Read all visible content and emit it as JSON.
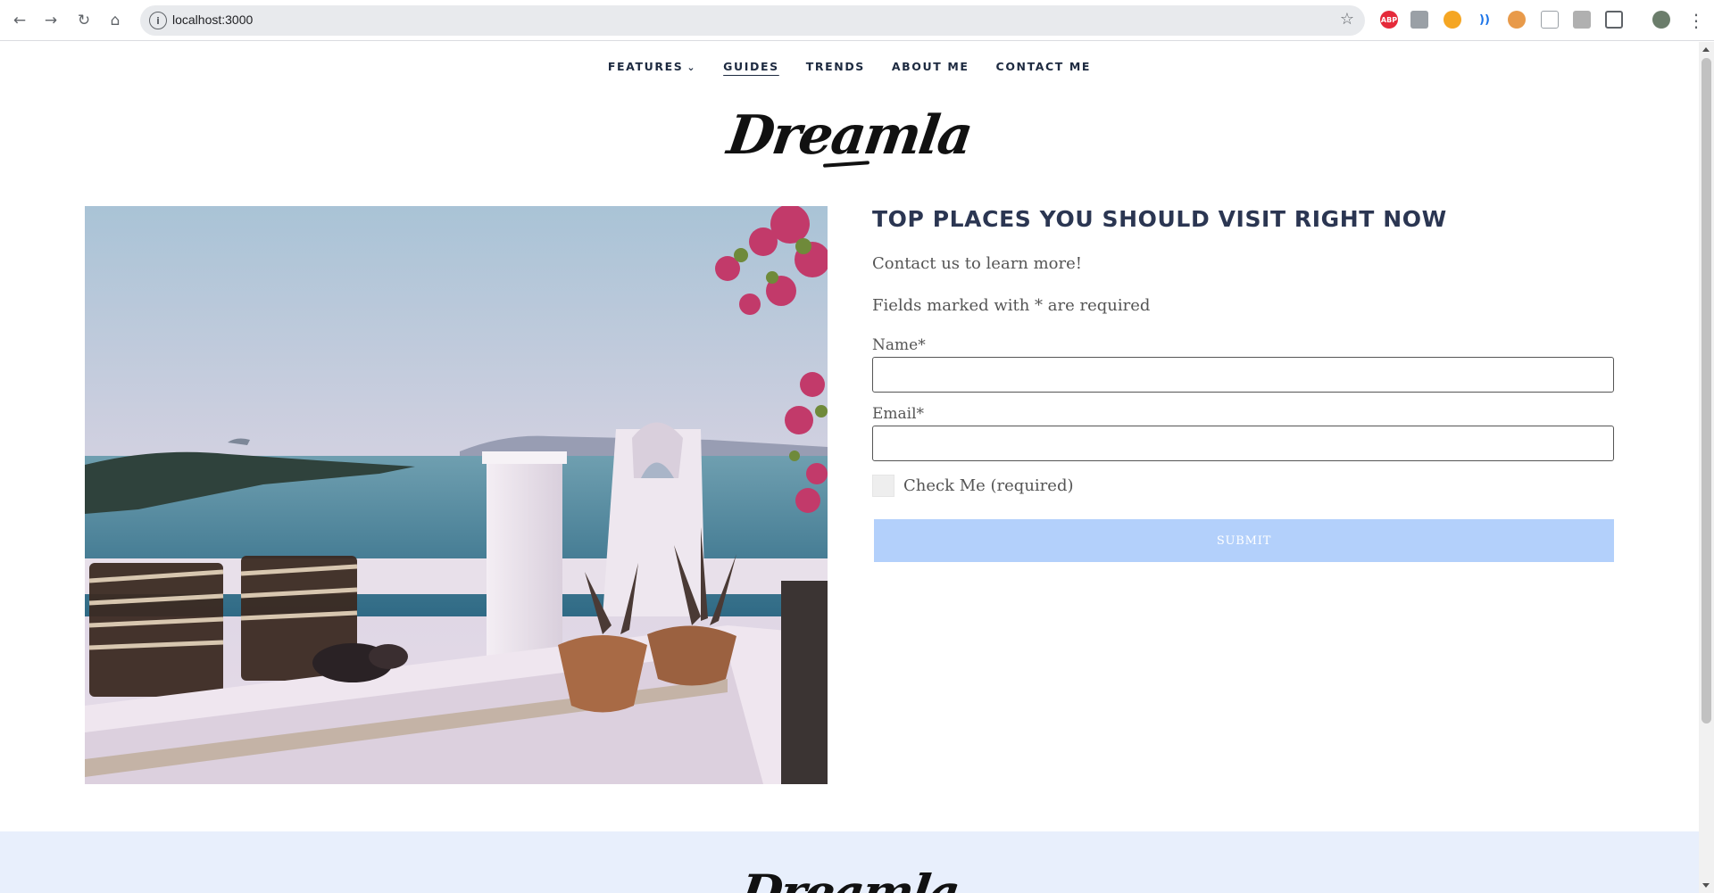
{
  "browser": {
    "url": "localhost:3000"
  },
  "nav": {
    "items": [
      {
        "label": "FEATURES"
      },
      {
        "label": "GUIDES"
      },
      {
        "label": "TRENDS"
      },
      {
        "label": "ABOUT ME"
      },
      {
        "label": "CONTACT ME"
      }
    ],
    "active": "GUIDES"
  },
  "brand": {
    "logo_text": "Dreamla"
  },
  "form": {
    "heading": "TOP PLACES YOU SHOULD VISIT RIGHT NOW",
    "intro": "Contact us to learn more!",
    "required_note": "Fields marked with * are required",
    "name_label": "Name*",
    "name_value": "",
    "email_label": "Email*",
    "email_value": "",
    "checkbox_label": "Check Me (required)",
    "checkbox_checked": false,
    "submit_label": "SUBMIT"
  },
  "colors": {
    "heading": "#2b3652",
    "submit_bg": "#b3d0fb",
    "footer_bg": "#e8effc"
  }
}
